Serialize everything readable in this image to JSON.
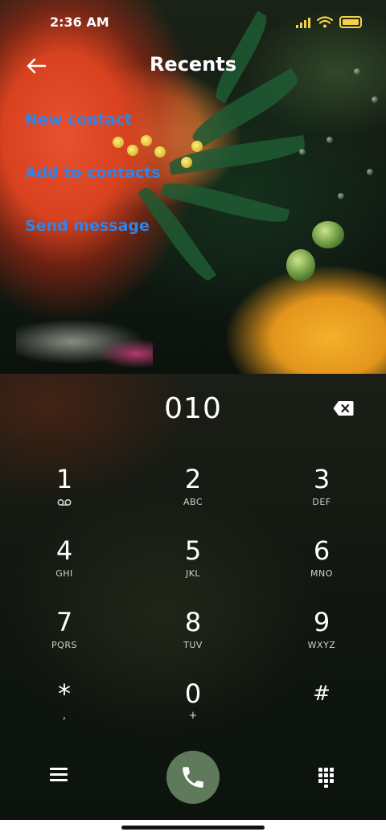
{
  "status_bar": {
    "time": "2:36 AM",
    "icons": [
      "signal-icon",
      "wifi-icon",
      "battery-icon"
    ],
    "accent_color": "#f3d24a"
  },
  "header": {
    "back_icon": "arrow-left-icon",
    "title": "Recents"
  },
  "actions": [
    {
      "label": "New contact"
    },
    {
      "label": "Add to contacts"
    },
    {
      "label": "Send message"
    }
  ],
  "link_color": "#2f84ea",
  "dialer": {
    "number": "010",
    "backspace_icon": "backspace-icon",
    "keys": [
      {
        "digit": "1",
        "sub": "",
        "sub_icon": "voicemail-icon"
      },
      {
        "digit": "2",
        "sub": "ABC"
      },
      {
        "digit": "3",
        "sub": "DEF"
      },
      {
        "digit": "4",
        "sub": "GHI"
      },
      {
        "digit": "5",
        "sub": "JKL"
      },
      {
        "digit": "6",
        "sub": "MNO"
      },
      {
        "digit": "7",
        "sub": "PQRS"
      },
      {
        "digit": "8",
        "sub": "TUV"
      },
      {
        "digit": "9",
        "sub": "WXYZ"
      },
      {
        "digit": "*",
        "sub": ","
      },
      {
        "digit": "0",
        "sub": "+"
      },
      {
        "digit": "#",
        "sub": ""
      }
    ]
  },
  "bottom_bar": {
    "menu_icon": "menu-icon",
    "call_icon": "phone-icon",
    "call_button_color": "#5e7a5b",
    "keypad_icon": "dialpad-icon"
  }
}
